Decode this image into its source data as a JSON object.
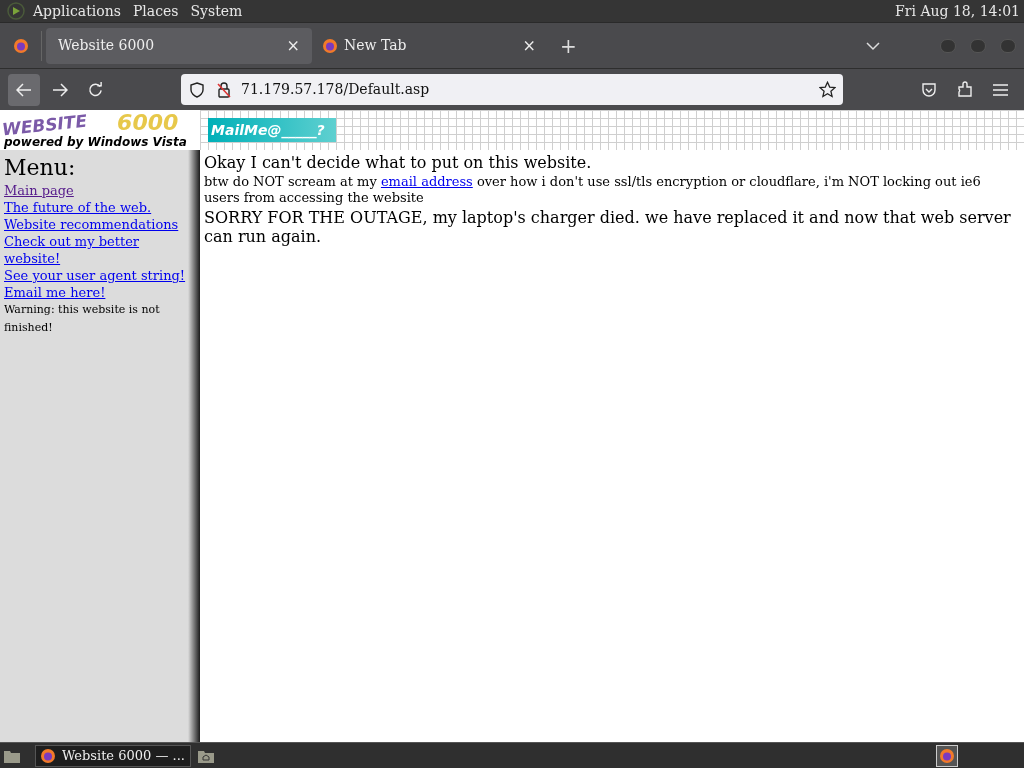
{
  "top_panel": {
    "menus": [
      "Applications",
      "Places",
      "System"
    ],
    "clock": "Fri Aug 18, 14:01"
  },
  "tabs": [
    {
      "label": "Website 6000",
      "selected": true,
      "close": "×"
    },
    {
      "label": "New Tab",
      "selected": false,
      "close": "×"
    }
  ],
  "new_tab": "+",
  "address_bar": {
    "url": "71.179.57.178/Default.asp"
  },
  "banner": {
    "logo_word": "WEBSITE",
    "logo_number": "6000",
    "tagline": "powered by Windows Vista",
    "mail_button": "MailMe@_____?"
  },
  "sidebar": {
    "heading": "Menu:",
    "links": [
      {
        "label": "Main page",
        "visited": true
      },
      {
        "label": "The future of the web.",
        "visited": false
      },
      {
        "label": "Website recommendations",
        "visited": false
      },
      {
        "label": "Check out my better website!",
        "visited": false
      },
      {
        "label": "See your user agent string!",
        "visited": false
      },
      {
        "label": "Email me here!",
        "visited": false
      }
    ],
    "warning": "Warning: this website is not finished!"
  },
  "content": {
    "title": "Okay I can't decide what to put on this website.",
    "note_before": "btw do NOT scream at my",
    "note_link": "email address",
    "note_after": "over how i don't use ssl/tls encryption or cloudflare, i'm NOT locking out ie6 users from accessing the website",
    "outage": "SORRY FOR THE OUTAGE, my laptop's charger died. we have replaced it and now that web server can run again."
  },
  "taskbar": {
    "window_button": "Website 6000 — ..."
  }
}
